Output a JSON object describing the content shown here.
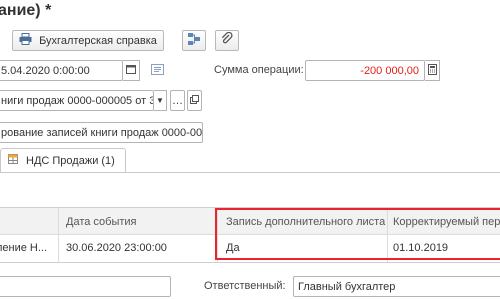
{
  "window": {
    "title": "ание) *"
  },
  "toolbar": {
    "print_label": "Бухгалтерская справка"
  },
  "form": {
    "date_value": "5.04.2020  0:00:00",
    "sum_label": "Сумма операции:",
    "sum_value": "-200 000,00",
    "book_value": "ниги продаж 0000-000005 от 30",
    "description_value": "рование записей книги продаж 0000-000",
    "responsible_label": "Ответственный:",
    "responsible_value": "Главный бухгалтер",
    "bottom_value": ""
  },
  "tabs": [
    {
      "label": "НДС Продажи (1)"
    }
  ],
  "table": {
    "headers": [
      "",
      "Дата события",
      "Запись дополнительного листа",
      "Корректируемый пери"
    ],
    "rows": [
      [
        "ление Н...",
        "30.06.2020 23:00:00",
        "Да",
        "01.10.2019"
      ]
    ]
  },
  "colors": {
    "highlight": "#e8242e",
    "negative_amount": "#e0201a",
    "header_bg": "#f2f2f2"
  },
  "icons": {
    "print": "printer-icon",
    "structure": "structure-icon",
    "attach": "paperclip-icon",
    "calendar": "calendar-icon",
    "note": "note-icon",
    "calculator": "calculator-icon",
    "tab": "table-icon"
  }
}
